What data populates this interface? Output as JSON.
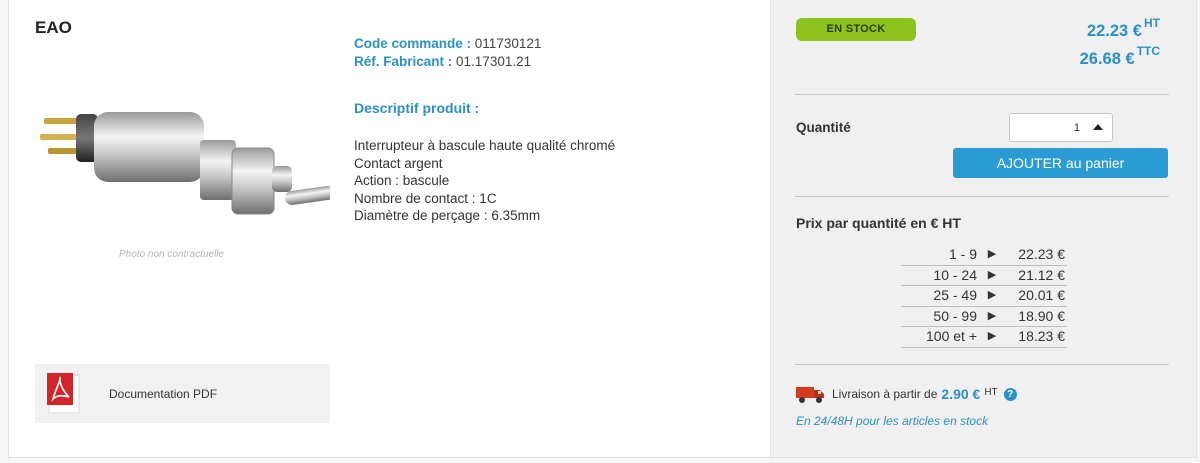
{
  "brand": "EAO",
  "product": {
    "photo_note": "Photo non contractuelle",
    "doc_label": "Documentation PDF",
    "code_label": "Code commande :",
    "code_value": "011730121",
    "ref_label": "Réf. Fabricant :",
    "ref_value": "01.17301.21",
    "desc_title": "Descriptif produit :",
    "desc_lines": [
      "Interrupteur à bascule haute qualité chromé",
      "Contact argent",
      "Action : bascule",
      "Nombre de contact : 1C",
      "Diamètre de perçage : 6.35mm"
    ]
  },
  "panel": {
    "stock_badge": "EN STOCK",
    "price_ht": "22.23 €",
    "ht_sup": "HT",
    "price_ttc": "26.68 €",
    "ttc_sup": "TTC",
    "quantity_label": "Quantité",
    "quantity_value": "1",
    "add_button": "AJOUTER au panier",
    "tier_title": "Prix par quantité en € HT",
    "tiers": [
      {
        "range": "1 - 9",
        "price": "22.23 €"
      },
      {
        "range": "10 - 24",
        "price": "21.12 €"
      },
      {
        "range": "25 - 49",
        "price": "20.01 €"
      },
      {
        "range": "50 - 99",
        "price": "18.90 €"
      },
      {
        "range": "100 et +",
        "price": "18.23 €"
      }
    ],
    "delivery_text": "Livraison à partir de",
    "delivery_price": "2.90 €",
    "delivery_sup": "HT",
    "help_glyph": "?",
    "delivery_delay": "En 24/48H pour les articles en stock"
  },
  "icons": [
    "pdf-icon",
    "truck-icon",
    "help-icon",
    "arrow-up-icon",
    "play-arrow-icon"
  ],
  "colors": {
    "accent": "#2a91c8",
    "stock_green": "#8cc21c",
    "button": "#2a9bd3",
    "pdf_red": "#d3262b",
    "truck_red": "#d43a1e"
  }
}
